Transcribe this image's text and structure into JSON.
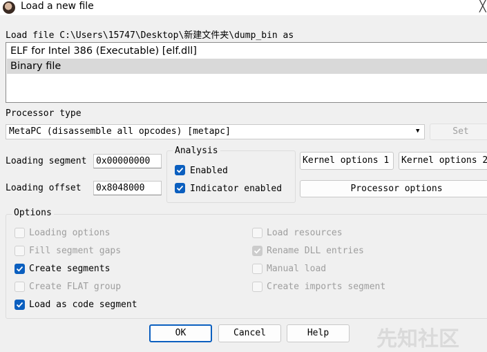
{
  "window": {
    "title": "Load a new file",
    "close_glyph": "╳"
  },
  "load_file_label": "Load file C:\\Users\\15747\\Desktop\\新建文件夹\\dump_bin as",
  "file_types": [
    {
      "label": "ELF for Intel 386 (Executable) [elf.dll]",
      "selected": false
    },
    {
      "label": "Binary file",
      "selected": true
    }
  ],
  "processor": {
    "label": "Processor type",
    "selected": "MetaPC (disassemble all opcodes) [metapc]",
    "set_button": "Set"
  },
  "loading_segment": {
    "label": "Loading segment",
    "value": "0x00000000"
  },
  "loading_offset": {
    "label": "Loading offset",
    "value": "0x8048000"
  },
  "analysis": {
    "title": "Analysis",
    "enabled": {
      "label": "Enabled",
      "checked": true
    },
    "indicator": {
      "label": "Indicator enabled",
      "checked": true
    }
  },
  "buttons": {
    "kernel1": "Kernel options 1",
    "kernel2": "Kernel options 2",
    "processor_options": "Processor options",
    "ok": "OK",
    "cancel": "Cancel",
    "help": "Help"
  },
  "options": {
    "title": "Options",
    "left": [
      {
        "label": "Loading options",
        "checked": false,
        "disabled": true
      },
      {
        "label": "Fill segment gaps",
        "checked": false,
        "disabled": true
      },
      {
        "label": "Create segments",
        "checked": true,
        "disabled": false
      },
      {
        "label": "Create FLAT group",
        "checked": false,
        "disabled": true
      },
      {
        "label": "Load as code segment",
        "checked": true,
        "disabled": false
      }
    ],
    "right": [
      {
        "label": "Load resources",
        "checked": false,
        "disabled": true
      },
      {
        "label": "Rename DLL entries",
        "checked": true,
        "disabled": true
      },
      {
        "label": "Manual load",
        "checked": false,
        "disabled": true
      },
      {
        "label": "Create imports segment",
        "checked": false,
        "disabled": true
      }
    ]
  },
  "watermark": "先知社区",
  "colors": {
    "accent": "#0b5fbf",
    "selection": "#d9d9d9",
    "background": "#f0f0f0"
  }
}
